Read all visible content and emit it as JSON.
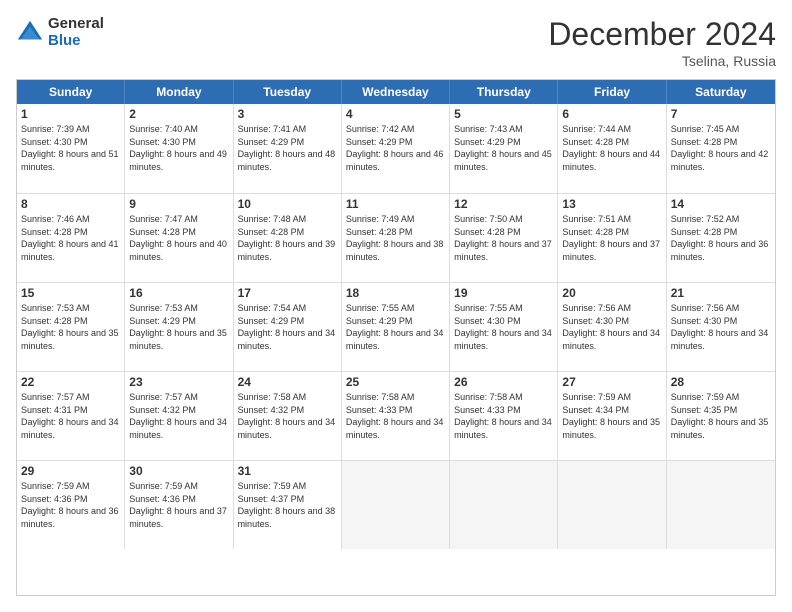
{
  "logo": {
    "general": "General",
    "blue": "Blue"
  },
  "title": "December 2024",
  "location": "Tselina, Russia",
  "days_of_week": [
    "Sunday",
    "Monday",
    "Tuesday",
    "Wednesday",
    "Thursday",
    "Friday",
    "Saturday"
  ],
  "weeks": [
    [
      {
        "day": 1,
        "sunrise": "Sunrise: 7:39 AM",
        "sunset": "Sunset: 4:30 PM",
        "daylight": "Daylight: 8 hours and 51 minutes."
      },
      {
        "day": 2,
        "sunrise": "Sunrise: 7:40 AM",
        "sunset": "Sunset: 4:30 PM",
        "daylight": "Daylight: 8 hours and 49 minutes."
      },
      {
        "day": 3,
        "sunrise": "Sunrise: 7:41 AM",
        "sunset": "Sunset: 4:29 PM",
        "daylight": "Daylight: 8 hours and 48 minutes."
      },
      {
        "day": 4,
        "sunrise": "Sunrise: 7:42 AM",
        "sunset": "Sunset: 4:29 PM",
        "daylight": "Daylight: 8 hours and 46 minutes."
      },
      {
        "day": 5,
        "sunrise": "Sunrise: 7:43 AM",
        "sunset": "Sunset: 4:29 PM",
        "daylight": "Daylight: 8 hours and 45 minutes."
      },
      {
        "day": 6,
        "sunrise": "Sunrise: 7:44 AM",
        "sunset": "Sunset: 4:28 PM",
        "daylight": "Daylight: 8 hours and 44 minutes."
      },
      {
        "day": 7,
        "sunrise": "Sunrise: 7:45 AM",
        "sunset": "Sunset: 4:28 PM",
        "daylight": "Daylight: 8 hours and 42 minutes."
      }
    ],
    [
      {
        "day": 8,
        "sunrise": "Sunrise: 7:46 AM",
        "sunset": "Sunset: 4:28 PM",
        "daylight": "Daylight: 8 hours and 41 minutes."
      },
      {
        "day": 9,
        "sunrise": "Sunrise: 7:47 AM",
        "sunset": "Sunset: 4:28 PM",
        "daylight": "Daylight: 8 hours and 40 minutes."
      },
      {
        "day": 10,
        "sunrise": "Sunrise: 7:48 AM",
        "sunset": "Sunset: 4:28 PM",
        "daylight": "Daylight: 8 hours and 39 minutes."
      },
      {
        "day": 11,
        "sunrise": "Sunrise: 7:49 AM",
        "sunset": "Sunset: 4:28 PM",
        "daylight": "Daylight: 8 hours and 38 minutes."
      },
      {
        "day": 12,
        "sunrise": "Sunrise: 7:50 AM",
        "sunset": "Sunset: 4:28 PM",
        "daylight": "Daylight: 8 hours and 37 minutes."
      },
      {
        "day": 13,
        "sunrise": "Sunrise: 7:51 AM",
        "sunset": "Sunset: 4:28 PM",
        "daylight": "Daylight: 8 hours and 37 minutes."
      },
      {
        "day": 14,
        "sunrise": "Sunrise: 7:52 AM",
        "sunset": "Sunset: 4:28 PM",
        "daylight": "Daylight: 8 hours and 36 minutes."
      }
    ],
    [
      {
        "day": 15,
        "sunrise": "Sunrise: 7:53 AM",
        "sunset": "Sunset: 4:28 PM",
        "daylight": "Daylight: 8 hours and 35 minutes."
      },
      {
        "day": 16,
        "sunrise": "Sunrise: 7:53 AM",
        "sunset": "Sunset: 4:29 PM",
        "daylight": "Daylight: 8 hours and 35 minutes."
      },
      {
        "day": 17,
        "sunrise": "Sunrise: 7:54 AM",
        "sunset": "Sunset: 4:29 PM",
        "daylight": "Daylight: 8 hours and 34 minutes."
      },
      {
        "day": 18,
        "sunrise": "Sunrise: 7:55 AM",
        "sunset": "Sunset: 4:29 PM",
        "daylight": "Daylight: 8 hours and 34 minutes."
      },
      {
        "day": 19,
        "sunrise": "Sunrise: 7:55 AM",
        "sunset": "Sunset: 4:30 PM",
        "daylight": "Daylight: 8 hours and 34 minutes."
      },
      {
        "day": 20,
        "sunrise": "Sunrise: 7:56 AM",
        "sunset": "Sunset: 4:30 PM",
        "daylight": "Daylight: 8 hours and 34 minutes."
      },
      {
        "day": 21,
        "sunrise": "Sunrise: 7:56 AM",
        "sunset": "Sunset: 4:30 PM",
        "daylight": "Daylight: 8 hours and 34 minutes."
      }
    ],
    [
      {
        "day": 22,
        "sunrise": "Sunrise: 7:57 AM",
        "sunset": "Sunset: 4:31 PM",
        "daylight": "Daylight: 8 hours and 34 minutes."
      },
      {
        "day": 23,
        "sunrise": "Sunrise: 7:57 AM",
        "sunset": "Sunset: 4:32 PM",
        "daylight": "Daylight: 8 hours and 34 minutes."
      },
      {
        "day": 24,
        "sunrise": "Sunrise: 7:58 AM",
        "sunset": "Sunset: 4:32 PM",
        "daylight": "Daylight: 8 hours and 34 minutes."
      },
      {
        "day": 25,
        "sunrise": "Sunrise: 7:58 AM",
        "sunset": "Sunset: 4:33 PM",
        "daylight": "Daylight: 8 hours and 34 minutes."
      },
      {
        "day": 26,
        "sunrise": "Sunrise: 7:58 AM",
        "sunset": "Sunset: 4:33 PM",
        "daylight": "Daylight: 8 hours and 34 minutes."
      },
      {
        "day": 27,
        "sunrise": "Sunrise: 7:59 AM",
        "sunset": "Sunset: 4:34 PM",
        "daylight": "Daylight: 8 hours and 35 minutes."
      },
      {
        "day": 28,
        "sunrise": "Sunrise: 7:59 AM",
        "sunset": "Sunset: 4:35 PM",
        "daylight": "Daylight: 8 hours and 35 minutes."
      }
    ],
    [
      {
        "day": 29,
        "sunrise": "Sunrise: 7:59 AM",
        "sunset": "Sunset: 4:36 PM",
        "daylight": "Daylight: 8 hours and 36 minutes."
      },
      {
        "day": 30,
        "sunrise": "Sunrise: 7:59 AM",
        "sunset": "Sunset: 4:36 PM",
        "daylight": "Daylight: 8 hours and 37 minutes."
      },
      {
        "day": 31,
        "sunrise": "Sunrise: 7:59 AM",
        "sunset": "Sunset: 4:37 PM",
        "daylight": "Daylight: 8 hours and 38 minutes."
      },
      null,
      null,
      null,
      null
    ]
  ]
}
